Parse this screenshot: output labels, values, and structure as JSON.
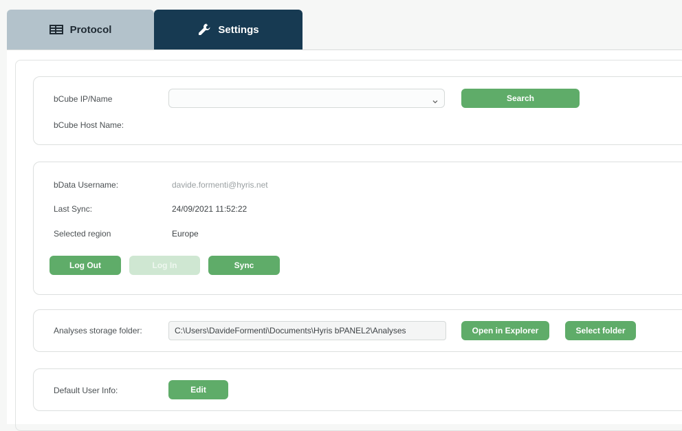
{
  "tabs": {
    "protocol": {
      "label": "Protocol",
      "icon": "table-icon"
    },
    "settings": {
      "label": "Settings",
      "icon": "wrench-icon",
      "active": true
    }
  },
  "bcube": {
    "ip_label": "bCube IP/Name",
    "ip_value": "",
    "host_label": "bCube Host Name:",
    "search_label": "Search"
  },
  "bdata": {
    "username_label": "bData Username:",
    "username_value": "davide.formenti@hyris.net",
    "last_sync_label": "Last Sync:",
    "last_sync_value": "24/09/2021 11:52:22",
    "region_label": "Selected region",
    "region_value": "Europe",
    "logout_label": "Log Out",
    "login_label": "Log In",
    "sync_label": "Sync"
  },
  "storage": {
    "label": "Analyses storage folder:",
    "path": "C:\\Users\\DavideFormenti\\Documents\\Hyris bPANEL2\\Analyses",
    "open_label": "Open in Explorer",
    "select_label": "Select folder"
  },
  "user": {
    "label": "Default User Info:",
    "edit_label": "Edit"
  },
  "colors": {
    "accent_green": "#5fac69",
    "tab_active": "#173a52",
    "tab_inactive": "#b3c2cb"
  }
}
